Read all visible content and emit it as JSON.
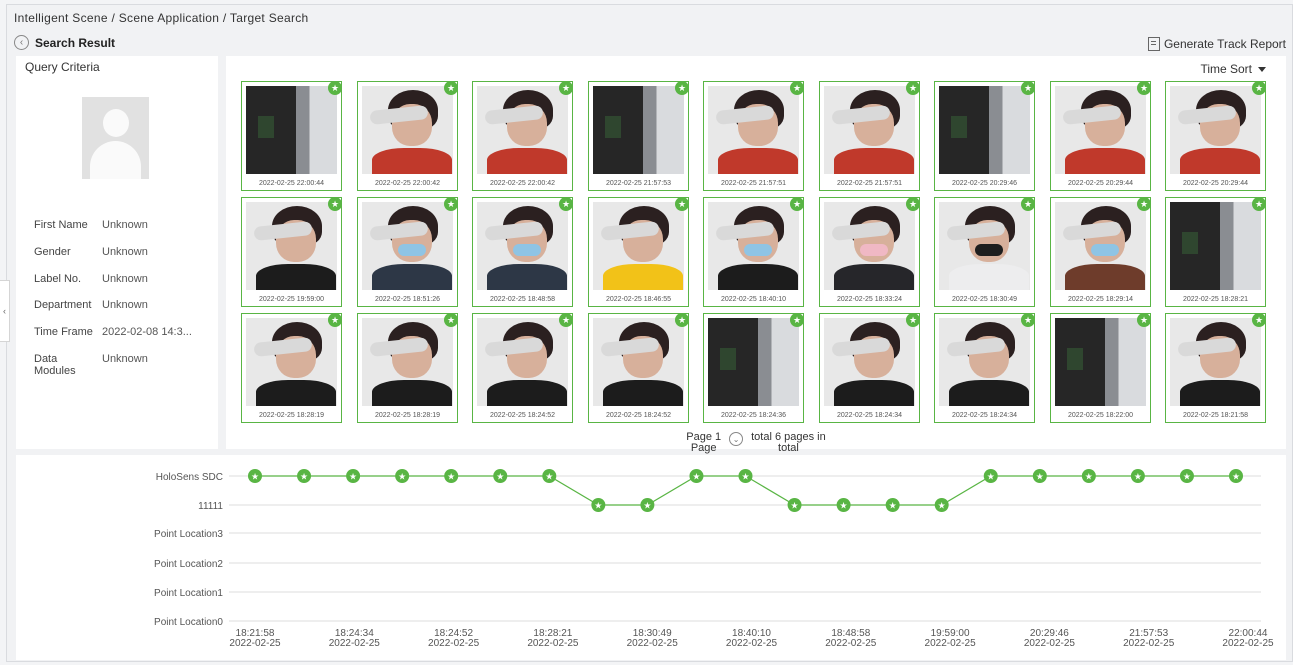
{
  "breadcrumb": "Intelligent Scene / Scene Application / Target Search",
  "header": {
    "title": "Search Result",
    "generate_label": "Generate Track Report"
  },
  "query": {
    "title": "Query Criteria",
    "fields": [
      {
        "label": "First Name",
        "value": "Unknown"
      },
      {
        "label": "Gender",
        "value": "Unknown"
      },
      {
        "label": "Label No.",
        "value": "Unknown"
      },
      {
        "label": "Department",
        "value": "Unknown"
      },
      {
        "label": "Time Frame",
        "value": "2022-02-08 14:3..."
      },
      {
        "label": "Data\nModules",
        "value": "Unknown"
      }
    ]
  },
  "sort_label": "Time Sort",
  "results": [
    {
      "ts": "2022-02-25 22:00:44",
      "kind": "dark"
    },
    {
      "ts": "2022-02-25 22:00:42",
      "kind": "face",
      "color": "red"
    },
    {
      "ts": "2022-02-25 22:00:42",
      "kind": "face",
      "color": "red"
    },
    {
      "ts": "2022-02-25 21:57:53",
      "kind": "dark"
    },
    {
      "ts": "2022-02-25 21:57:51",
      "kind": "face",
      "color": "red"
    },
    {
      "ts": "2022-02-25 21:57:51",
      "kind": "face",
      "color": "red"
    },
    {
      "ts": "2022-02-25 20:29:46",
      "kind": "dark"
    },
    {
      "ts": "2022-02-25 20:29:44",
      "kind": "face",
      "color": "red"
    },
    {
      "ts": "2022-02-25 20:29:44",
      "kind": "face",
      "color": "red"
    },
    {
      "ts": "2022-02-25 19:59:00",
      "kind": "face",
      "color": "black"
    },
    {
      "ts": "2022-02-25 18:51:26",
      "kind": "face",
      "color": "blue",
      "mask": "blue"
    },
    {
      "ts": "2022-02-25 18:48:58",
      "kind": "face",
      "color": "blue",
      "mask": "blue"
    },
    {
      "ts": "2022-02-25 18:46:55",
      "kind": "face",
      "color": "yellow"
    },
    {
      "ts": "2022-02-25 18:40:10",
      "kind": "face",
      "color": "black",
      "mask": "blue"
    },
    {
      "ts": "2022-02-25 18:33:24",
      "kind": "face",
      "color": "pink",
      "mask": "pink"
    },
    {
      "ts": "2022-02-25 18:30:49",
      "kind": "face",
      "color": "white",
      "mask": "black"
    },
    {
      "ts": "2022-02-25 18:29:14",
      "kind": "face",
      "color": "brown",
      "mask": "blue"
    },
    {
      "ts": "2022-02-25 18:28:21",
      "kind": "dark"
    },
    {
      "ts": "2022-02-25 18:28:19",
      "kind": "face",
      "color": "black"
    },
    {
      "ts": "2022-02-25 18:28:19",
      "kind": "face",
      "color": "black"
    },
    {
      "ts": "2022-02-25 18:24:52",
      "kind": "face",
      "color": "black"
    },
    {
      "ts": "2022-02-25 18:24:52",
      "kind": "face",
      "color": "black"
    },
    {
      "ts": "2022-02-25 18:24:36",
      "kind": "dark"
    },
    {
      "ts": "2022-02-25 18:24:34",
      "kind": "face",
      "color": "black"
    },
    {
      "ts": "2022-02-25 18:24:34",
      "kind": "face",
      "color": "black"
    },
    {
      "ts": "2022-02-25 18:22:00",
      "kind": "dark"
    },
    {
      "ts": "2022-02-25 18:21:58",
      "kind": "face",
      "color": "black"
    }
  ],
  "pagination": {
    "page_a": "Page 1",
    "page_b": "Page",
    "total_a": "total 6 pages in",
    "total_b": "total"
  },
  "timeline": {
    "lanes": [
      "HoloSens SDC",
      "11111",
      "Point Location3",
      "Point Location2",
      "Point Location1",
      "Point Location0"
    ],
    "ticks": [
      [
        "18:21:58",
        "2022-02-25"
      ],
      [
        "18:24:34",
        "2022-02-25"
      ],
      [
        "18:24:52",
        "2022-02-25"
      ],
      [
        "18:28:21",
        "2022-02-25"
      ],
      [
        "18:30:49",
        "2022-02-25"
      ],
      [
        "18:40:10",
        "2022-02-25"
      ],
      [
        "18:48:58",
        "2022-02-25"
      ],
      [
        "19:59:00",
        "2022-02-25"
      ],
      [
        "20:29:46",
        "2022-02-25"
      ],
      [
        "21:57:53",
        "2022-02-25"
      ],
      [
        "22:00:44",
        "2022-02-25"
      ]
    ],
    "points": [
      0,
      0,
      0,
      0,
      0,
      0,
      0,
      1,
      1,
      0,
      0,
      1,
      1,
      1,
      1,
      0,
      0,
      0,
      0,
      0,
      0
    ],
    "color": "#59b544"
  }
}
